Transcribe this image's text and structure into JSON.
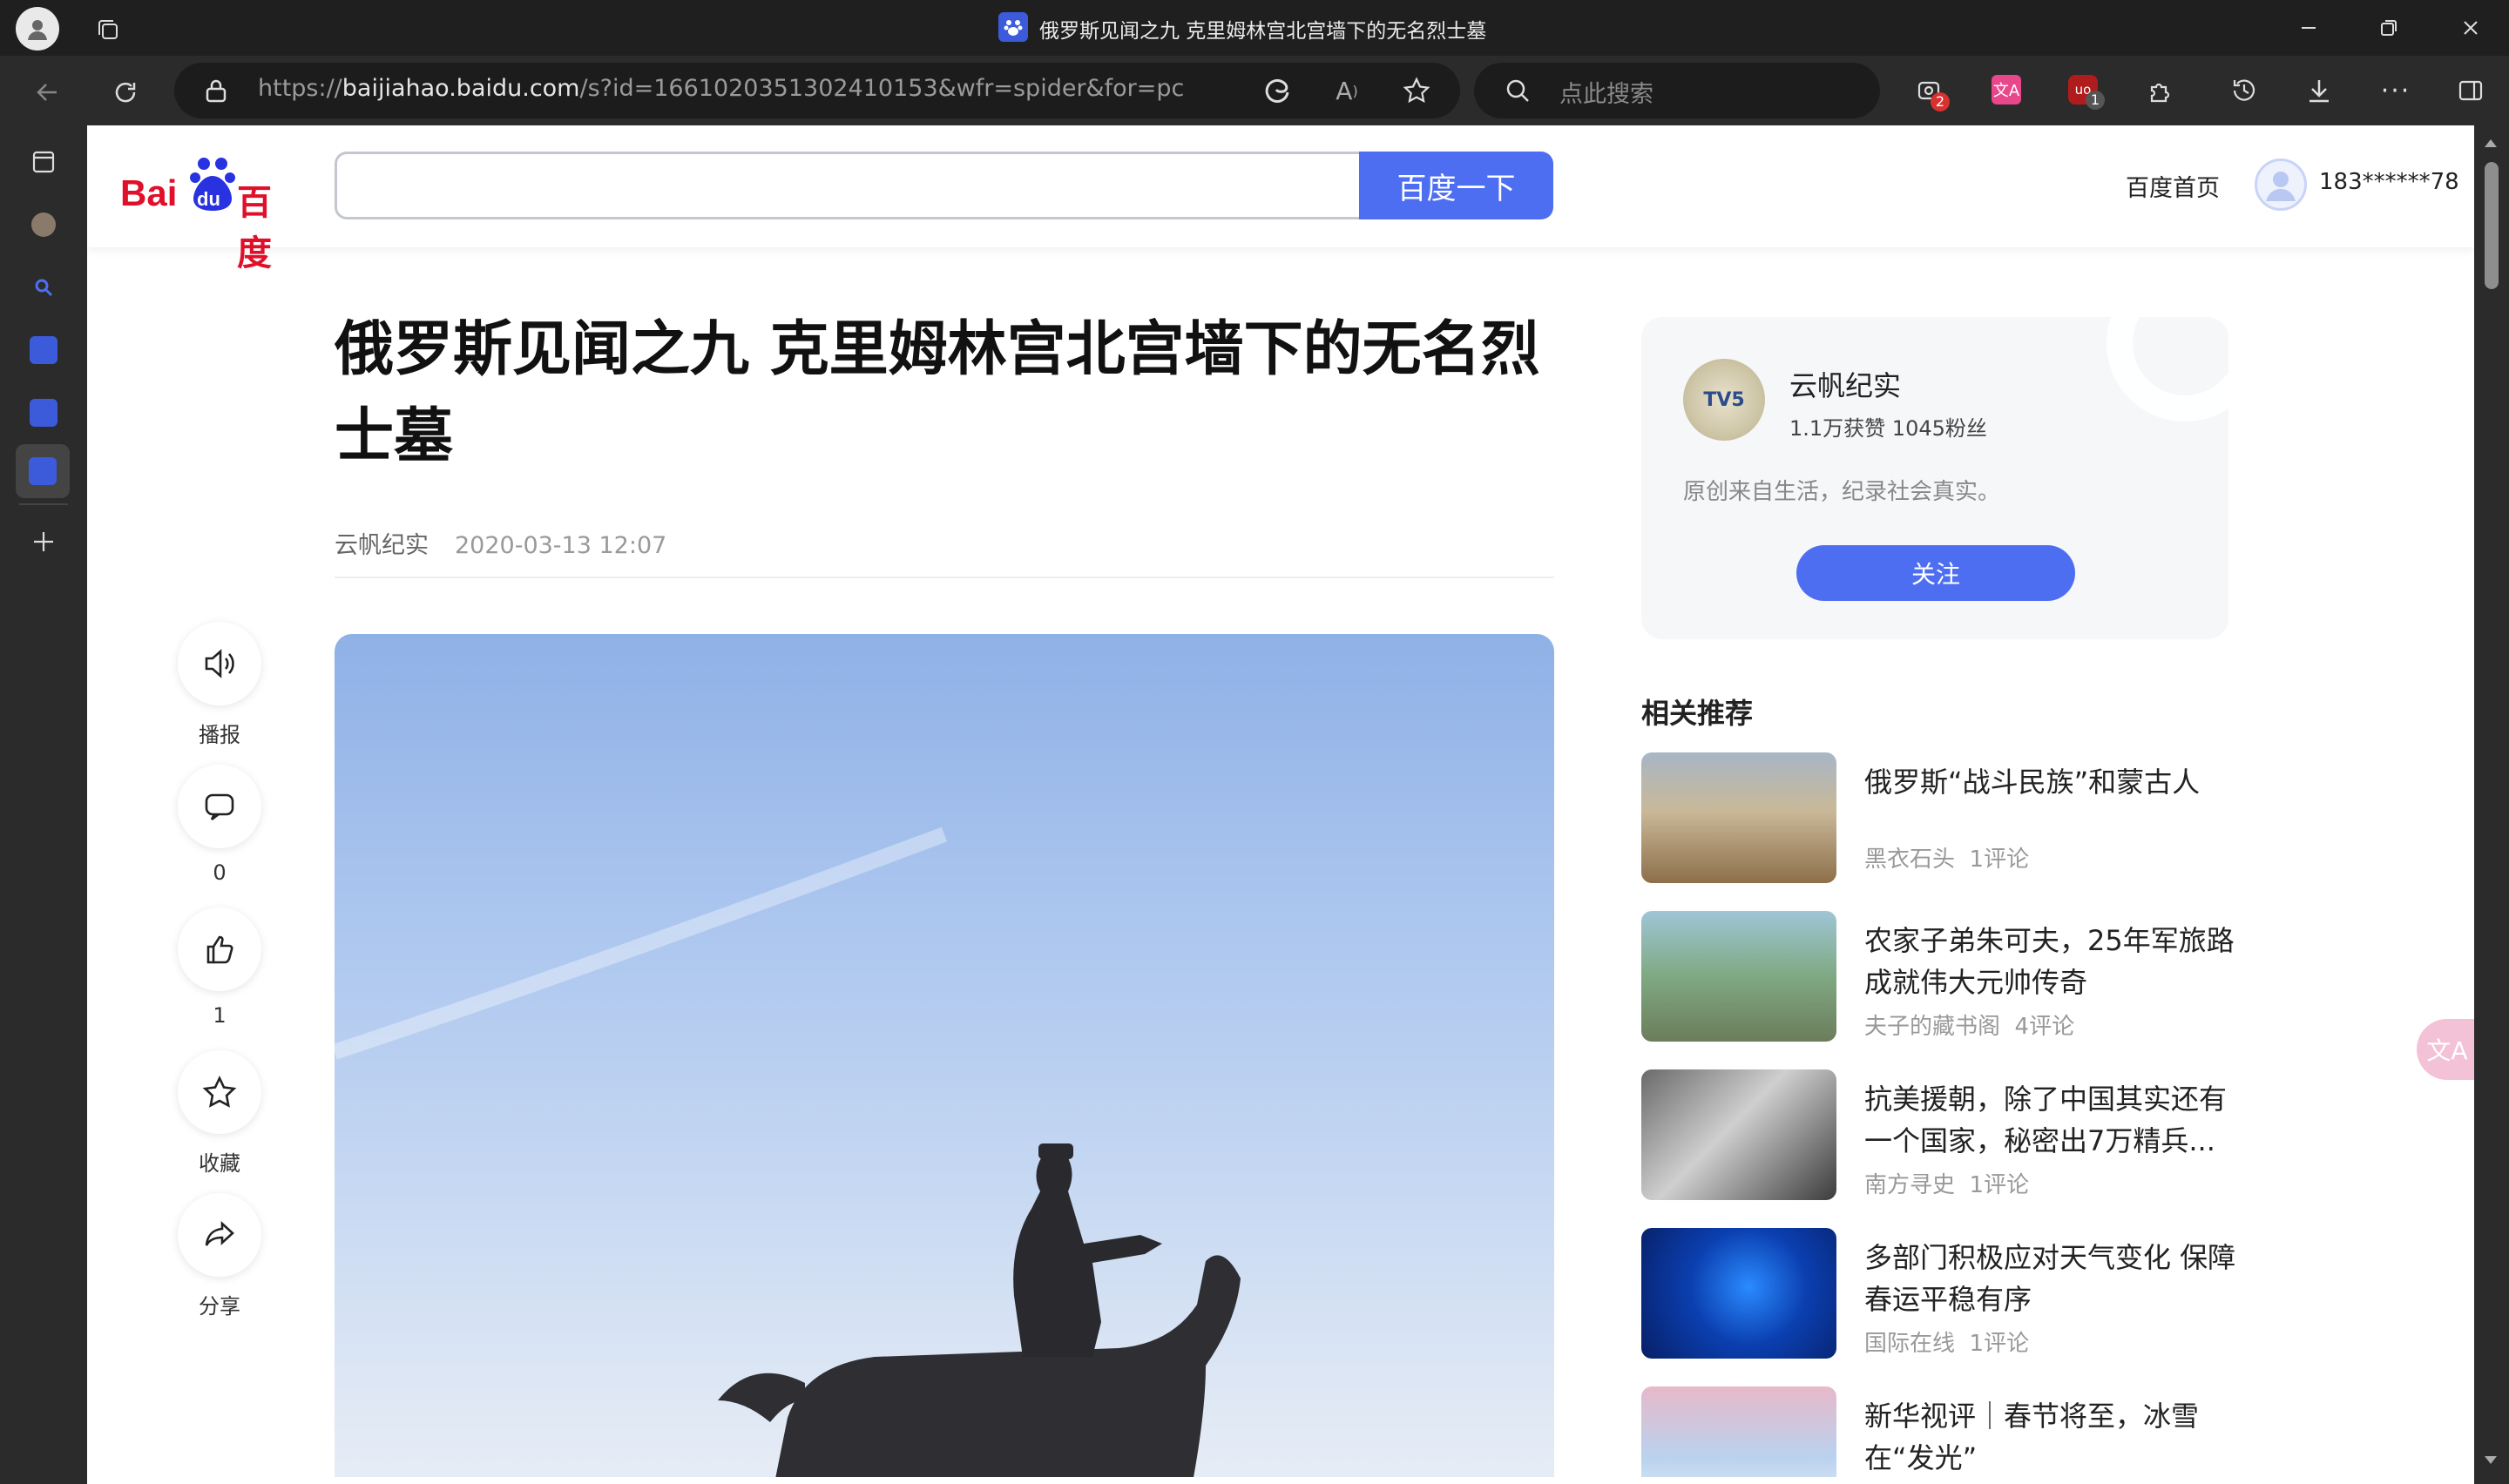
{
  "browser": {
    "tab_title": "俄罗斯见闻之九 克里姆林宫北宫墙下的无名烈士墓",
    "url_prefix": "https://",
    "url_host": "baijiahao.baidu.com",
    "url_rest": "/s?id=1661020351302410153&wfr=spider&for=pc",
    "search_placeholder": "点此搜索",
    "ext_badge_1": "2",
    "ext_badge_2": "1",
    "icons": [
      "profile-icon",
      "tab-actions-icon",
      "back-icon",
      "refresh-icon",
      "lock-icon",
      "edge-icon",
      "read-aloud-icon",
      "favorite-icon",
      "search-icon",
      "extension-1-icon",
      "translate-icon",
      "ublock-icon",
      "extensions-icon",
      "history-icon",
      "download-icon",
      "more-icon",
      "sidebar-toggle-icon",
      "minimize-icon",
      "restore-icon",
      "close-icon"
    ],
    "accent": "#4e6ef2"
  },
  "baidu": {
    "logo_text": "Bai百度",
    "logo_du": "du",
    "search_button": "百度一下",
    "home_link": "百度首页",
    "username": "183******78"
  },
  "article": {
    "title": "俄罗斯见闻之九 克里姆林宫北宫墙下的无名烈士墓",
    "author": "云帆纪实",
    "date": "2020-03-13 12:07"
  },
  "actions": [
    {
      "label": "播报",
      "icon": "speaker-icon"
    },
    {
      "label": "0",
      "icon": "comment-icon"
    },
    {
      "label": "1",
      "icon": "like-icon"
    },
    {
      "label": "收藏",
      "icon": "star-icon"
    },
    {
      "label": "分享",
      "icon": "share-icon"
    }
  ],
  "author_card": {
    "avatar_text": "TV5",
    "name": "云帆纪实",
    "stats": "1.1万获赞 1045粉丝",
    "desc": "原创来自生活，纪录社会真实。",
    "follow": "关注"
  },
  "recommend": {
    "heading": "相关推荐",
    "items": [
      {
        "title": "俄罗斯“战斗民族”和蒙古人",
        "source": "黑衣石头",
        "comments": "1评论"
      },
      {
        "title": "农家子弟朱可夫，25年军旅路成就伟大元帅传奇",
        "source": "夫子的藏书阁",
        "comments": "4评论"
      },
      {
        "title": "抗美援朝，除了中国其实还有一个国家，秘密出7万精兵...",
        "source": "南方寻史",
        "comments": "1评论"
      },
      {
        "title": "多部门积极应对天气变化 保障春运平稳有序",
        "source": "国际在线",
        "comments": "1评论"
      },
      {
        "title": "新华视评｜春节将至，冰雪在“发光”",
        "source": "",
        "comments": ""
      }
    ]
  }
}
